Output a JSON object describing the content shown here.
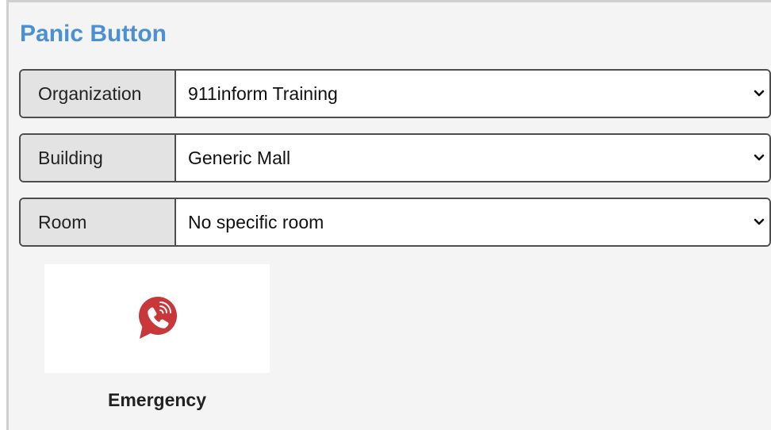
{
  "page": {
    "title": "Panic Button"
  },
  "fields": {
    "organization": {
      "label": "Organization",
      "value": "911inform Training"
    },
    "building": {
      "label": "Building",
      "value": "Generic Mall"
    },
    "room": {
      "label": "Room",
      "value": "No specific room"
    }
  },
  "actions": [
    {
      "label": "Emergency",
      "icon": "phone-speech-bubble-icon",
      "color": "#c8373a"
    }
  ],
  "colors": {
    "title": "#4a90d2",
    "icon_bg": "#c8373a"
  }
}
